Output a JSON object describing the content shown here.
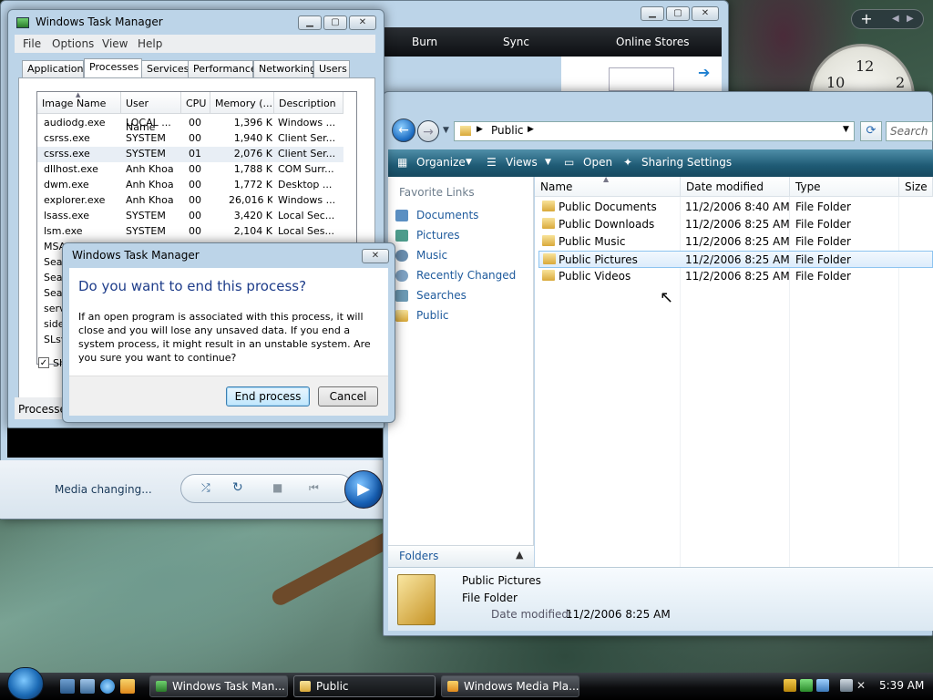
{
  "media_player": {
    "nav": {
      "burn": "Burn",
      "sync": "Sync",
      "online_stores": "Online Stores"
    },
    "status": "Media changing..."
  },
  "task_manager": {
    "title": "Windows Task Manager",
    "menu": [
      "File",
      "Options",
      "View",
      "Help"
    ],
    "tabs": [
      "Applications",
      "Processes",
      "Services",
      "Performance",
      "Networking",
      "Users"
    ],
    "active_tab": "Processes",
    "columns": [
      "Image Name",
      "User Name",
      "CPU",
      "Memory (...",
      "Description"
    ],
    "rows": [
      [
        "audiodg.exe",
        "LOCAL ...",
        "00",
        "1,396 K",
        "Windows ..."
      ],
      [
        "csrss.exe",
        "SYSTEM",
        "00",
        "1,940 K",
        "Client Ser..."
      ],
      [
        "csrss.exe",
        "SYSTEM",
        "01",
        "2,076 K",
        "Client Ser..."
      ],
      [
        "dllhost.exe",
        "Anh Khoa",
        "00",
        "1,788 K",
        "COM Surr..."
      ],
      [
        "dwm.exe",
        "Anh Khoa",
        "00",
        "1,772 K",
        "Desktop ..."
      ],
      [
        "explorer.exe",
        "Anh Khoa",
        "00",
        "26,016 K",
        "Windows ..."
      ],
      [
        "lsass.exe",
        "SYSTEM",
        "00",
        "3,420 K",
        "Local Sec..."
      ],
      [
        "lsm.exe",
        "SYSTEM",
        "00",
        "2,104 K",
        "Local Ses..."
      ],
      [
        "MSA",
        "",
        "",
        "",
        ""
      ],
      [
        "Sear",
        "",
        "",
        "",
        ""
      ],
      [
        "Sear",
        "",
        "",
        "",
        ""
      ],
      [
        "Sear",
        "",
        "",
        "",
        ""
      ],
      [
        "serv",
        "",
        "",
        "",
        ""
      ],
      [
        "side",
        "",
        "",
        "",
        ""
      ],
      [
        "SLsv",
        "",
        "",
        "",
        ""
      ]
    ],
    "show_label": "Sh",
    "status": "Processes"
  },
  "dialog": {
    "title": "Windows Task Manager",
    "heading": "Do you want to end this process?",
    "body": "If an open program is associated with this process, it will close and you will lose any unsaved data. If you end a system process, it might result in an unstable system. Are you sure you want to continue?",
    "end_button": "End process",
    "cancel_button": "Cancel"
  },
  "explorer": {
    "breadcrumb": "Public",
    "search_placeholder": "Search",
    "toolbar": {
      "organize": "Organize",
      "views": "Views",
      "open": "Open",
      "sharing": "Sharing Settings"
    },
    "favorite_links_label": "Favorite Links",
    "favorite_links": [
      "Documents",
      "Pictures",
      "Music",
      "Recently Changed",
      "Searches",
      "Public"
    ],
    "folders_label": "Folders",
    "columns": [
      "Name",
      "Date modified",
      "Type",
      "Size"
    ],
    "files": [
      [
        "Public Documents",
        "11/2/2006 8:40 AM",
        "File Folder"
      ],
      [
        "Public Downloads",
        "11/2/2006 8:25 AM",
        "File Folder"
      ],
      [
        "Public Music",
        "11/2/2006 8:25 AM",
        "File Folder"
      ],
      [
        "Public Pictures",
        "11/2/2006 8:25 AM",
        "File Folder"
      ],
      [
        "Public Videos",
        "11/2/2006 8:25 AM",
        "File Folder"
      ]
    ],
    "selected_index": 3,
    "details": {
      "name": "Public Pictures",
      "type": "File Folder",
      "date_label": "Date modified:",
      "date_value": "11/2/2006 8:25 AM"
    }
  },
  "taskbar": {
    "buttons": [
      "Windows Task Man...",
      "Public",
      "Windows Media Pla..."
    ],
    "clock": "5:39 AM"
  },
  "clock_gadget": {
    "n10": "10",
    "n12": "12",
    "n2": "2"
  },
  "colors": {
    "accent": "#1e5a9c",
    "dialog_heading": "#1e3d8a",
    "toolbar": "#1e5a74"
  }
}
